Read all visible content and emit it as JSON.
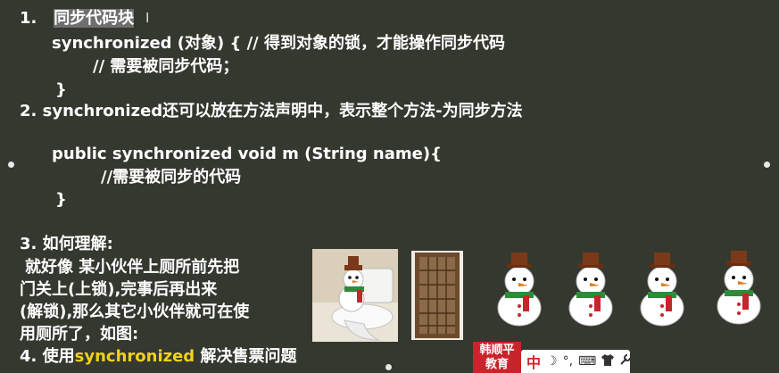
{
  "lines": {
    "l1_num": "1.",
    "l1_hl": "同步代码块",
    "l2": "synchronized (对象) {   // 得到对象的锁，才能操作同步代码",
    "l3": "// 需要被同步代码；",
    "l4": "}",
    "l5": "2.   synchronized还可以放在方法声明中，表示整个方法-为同步方法",
    "l6": "public synchronized void m (String name){",
    "l7": "//需要被同步的代码",
    "l8": "}",
    "l9": "3. 如何理解:",
    "l10": "就好像 某小伙伴上厕所前先把",
    "l11": "门关上(上锁),完事后再出来",
    "l12": "(解锁),那么其它小伙伴就可在使",
    "l13": "用厕所了，如图:",
    "l14_pre": "4. 使用",
    "l14_kw": "synchronized",
    "l14_post": " 解决售票问题"
  },
  "cursor_glyph": "I",
  "badge": {
    "line1": "韩顺平",
    "line2": "教育"
  },
  "ime": {
    "lang": "中",
    "icons": [
      "moon-icon",
      "punctuation-icon",
      "keyboard-icon",
      "shirt-icon",
      "wrench-icon"
    ]
  },
  "colors": {
    "background": "#34382f",
    "accent": "#f2d11c",
    "highlight": "#6f6f6f",
    "badge": "#c8242b"
  }
}
